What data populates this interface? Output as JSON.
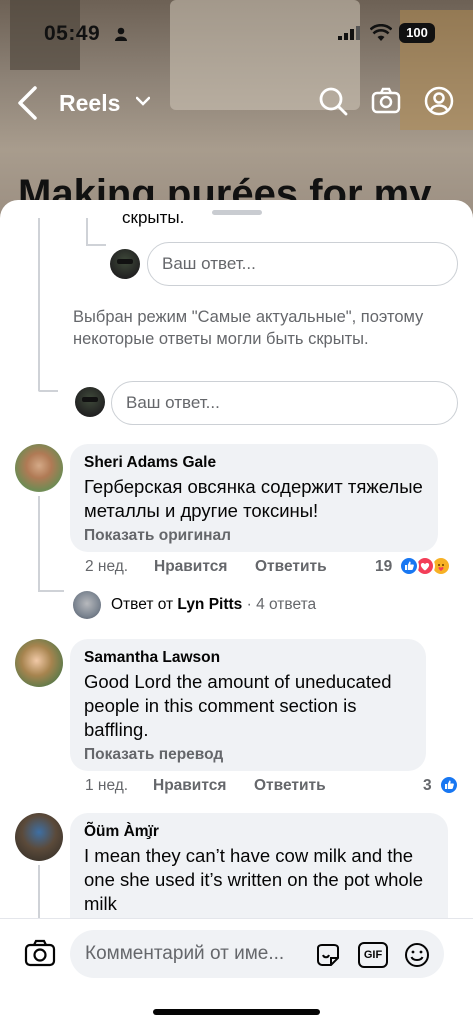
{
  "status_bar": {
    "time": "05:49",
    "battery": "100"
  },
  "header": {
    "title": "Reels",
    "reel_title": "Making purées for my"
  },
  "thread_top": {
    "truncated_text": "скрыты.",
    "reply_placeholder": "Ваш ответ...",
    "filter_notice": "Выбран режим \"Самые актуальные\", поэтому некоторые ответы могли быть скрыты.",
    "reply_placeholder_2": "Ваш ответ..."
  },
  "comments": [
    {
      "author": "Sheri Adams Gale",
      "text": "Герберская овсянка содержит тяжелые металлы и другие токсины!",
      "link": "Показать оригинал",
      "time": "2 нед.",
      "like_label": "Нравится",
      "reply_label": "Ответить",
      "reaction_count": "19",
      "replies_summary": {
        "prefix": "Ответ от",
        "author": "Lyn Pitts",
        "count": "· 4 ответа"
      }
    },
    {
      "author": "Samantha Lawson",
      "text": "Good Lord the amount of uneducated people in this comment section is baffling.",
      "link": "Показать перевод",
      "time": "1 нед.",
      "like_label": "Нравится",
      "reply_label": "Ответить",
      "reaction_count": "3"
    },
    {
      "author": "Õüm Àm̧ïr",
      "text": "I mean they can’t have cow milk and the one she used it’s written on the pot whole milk"
    }
  ],
  "composer": {
    "placeholder": "Комментарий от име...",
    "gif_label": "GIF"
  },
  "colors": {
    "like_blue": "#1877f2",
    "love_red": "#f33e58",
    "care_yellow": "#f7b125"
  }
}
